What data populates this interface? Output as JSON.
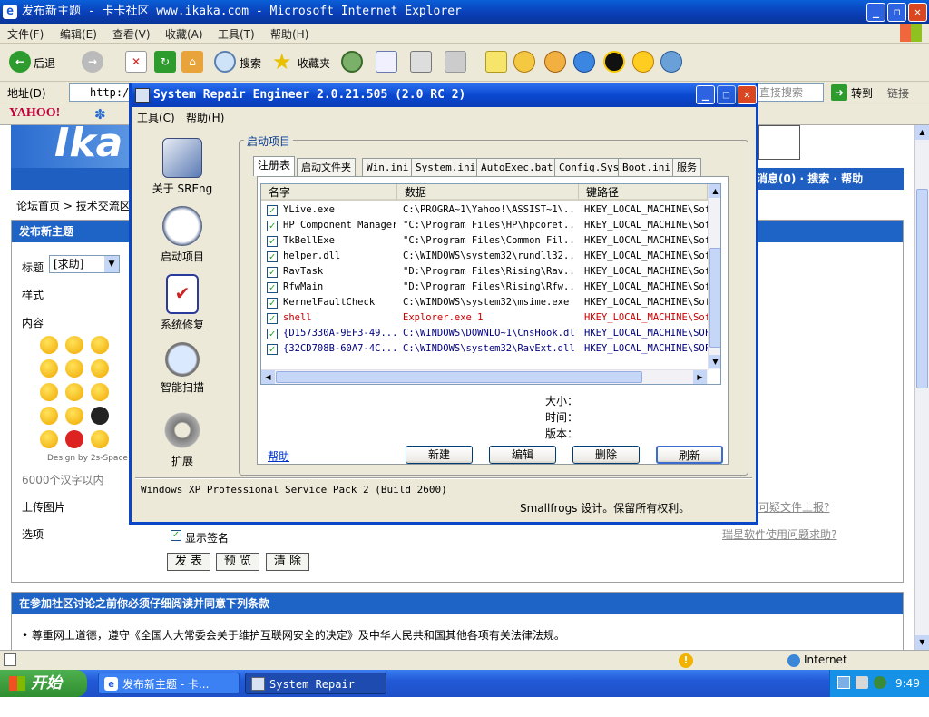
{
  "ie": {
    "title": "发布新主题 - 卡卡社区 www.ikaka.com - Microsoft Internet Explorer",
    "menu": [
      "文件(F)",
      "编辑(E)",
      "查看(V)",
      "收藏(A)",
      "工具(T)",
      "帮助(H)"
    ],
    "toolbar": {
      "back": "后退",
      "search": "搜索",
      "favorites": "收藏夹"
    },
    "address_label": "地址(D)",
    "address_value": "http://",
    "search_box": "直接搜索",
    "go": "转到",
    "links": "链接",
    "yahoo": "YAHOO!",
    "status": "Internet"
  },
  "page": {
    "logo_text": "Ika",
    "nav_right": "消息(0) · 搜索 · 帮助",
    "nav_tail": "短",
    "breadcrumb": [
      "论坛首页",
      "技术交流区"
    ],
    "header": "发布新主题",
    "title_label": "标题",
    "title_select": "[求助]",
    "style_label": "样式",
    "content_label": "内容",
    "design_by": "Design by 2s-Space",
    "char_limit": "6000个汉字以内",
    "upload_label": "上传图片",
    "options_label": "选项",
    "show_signature": "显示签名",
    "buttons": [
      "发 表",
      "预 览",
      "清 除"
    ],
    "report_link": "可疑文件上报?",
    "help_link": "瑞星软件使用问题求助?",
    "rules_header": "在参加社区讨论之前你必须仔细阅读并同意下列条款",
    "rule1": "尊重网上道德，遵守《全国人大常委会关于维护互联网安全的决定》及中华人民共和国其他各项有关法律法规。"
  },
  "sre": {
    "title": "System Repair Engineer 2.0.21.505 (2.0 RC 2)",
    "menu": [
      "工具(C)",
      "帮助(H)"
    ],
    "sidebar": [
      "关于 SREng",
      "启动项目",
      "系统修复",
      "智能扫描",
      "扩展"
    ],
    "group_title": "启动项目",
    "tabs": [
      "注册表",
      "启动文件夹",
      "Win.ini",
      "System.ini",
      "AutoExec.bat",
      "Config.Sys",
      "Boot.ini",
      "服务"
    ],
    "columns": [
      "名字",
      "数据",
      "键路径"
    ],
    "rows": [
      {
        "name": "YLive.exe",
        "data": "C:\\PROGRA~1\\Yahoo!\\ASSIST~1\\...",
        "key": "HKEY_LOCAL_MACHINE\\Sof",
        "color": "#000000"
      },
      {
        "name": "HP Component Manager",
        "data": "\"C:\\Program Files\\HP\\hpcoret...",
        "key": "HKEY_LOCAL_MACHINE\\Sof",
        "color": "#000000"
      },
      {
        "name": "TkBellExe",
        "data": "\"C:\\Program Files\\Common Fil...",
        "key": "HKEY_LOCAL_MACHINE\\Sof",
        "color": "#000000"
      },
      {
        "name": "helper.dll",
        "data": "C:\\WINDOWS\\system32\\rundll32...",
        "key": "HKEY_LOCAL_MACHINE\\Sof",
        "color": "#000000"
      },
      {
        "name": "RavTask",
        "data": "\"D:\\Program Files\\Rising\\Rav...",
        "key": "HKEY_LOCAL_MACHINE\\Sof",
        "color": "#000000"
      },
      {
        "name": "RfwMain",
        "data": "\"D:\\Program Files\\Rising\\Rfw...",
        "key": "HKEY_LOCAL_MACHINE\\Sof",
        "color": "#000000"
      },
      {
        "name": "KernelFaultCheck",
        "data": "C:\\WINDOWS\\system32\\msime.exe",
        "key": "HKEY_LOCAL_MACHINE\\Sof",
        "color": "#000000"
      },
      {
        "name": "shell",
        "data": "Explorer.exe 1",
        "key": "HKEY_LOCAL_MACHINE\\Sof",
        "color": "#cc0000"
      },
      {
        "name": "{D157330A-9EF3-49...",
        "data": "C:\\WINDOWS\\DOWNLO~1\\CnsHook.dll",
        "key": "HKEY_LOCAL_MACHINE\\SOF",
        "color": "#00007f"
      },
      {
        "name": "{32CD708B-60A7-4C...",
        "data": "C:\\WINDOWS\\system32\\RavExt.dll",
        "key": "HKEY_LOCAL_MACHINE\\SOF",
        "color": "#00007f"
      }
    ],
    "size_label": "大小：",
    "time_label": "时间：",
    "version_label": "版本：",
    "help_link": "帮助",
    "buttons": {
      "new": "新建",
      "edit": "编辑",
      "delete": "删除",
      "refresh": "刷新"
    },
    "os_info": "Windows XP Professional Service Pack 2 (Build 2600)",
    "copyright": "Smallfrogs 设计。保留所有权利。"
  },
  "taskbar": {
    "start": "开始",
    "tasks": [
      "发布新主题 - 卡...",
      "System Repair En..."
    ],
    "clock": "9:49"
  }
}
